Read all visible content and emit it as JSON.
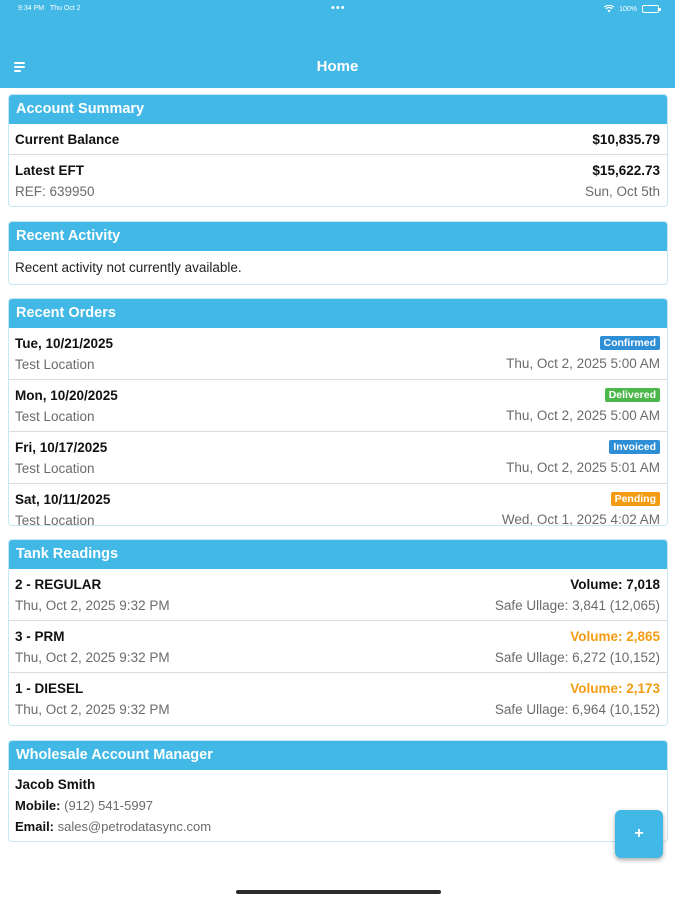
{
  "status_bar": {
    "time": "9:34 PM",
    "date": "Thu Oct 2",
    "dots": "•••",
    "battery": "100%"
  },
  "header": {
    "title": "Home",
    "menu_icon": "hamburger-menu-icon"
  },
  "colors": {
    "accent": "#42b8e6",
    "confirmed": "#2e8fd6",
    "delivered": "#4cb84c",
    "invoiced": "#2e8fd6",
    "pending": "#f39c12",
    "warning_text": "#f39c12"
  },
  "account_summary": {
    "title": "Account Summary",
    "current_balance_label": "Current Balance",
    "current_balance_value": "$10,835.79",
    "latest_eft_label": "Latest EFT",
    "latest_eft_value": "$15,622.73",
    "latest_eft_ref": "REF: 639950",
    "latest_eft_date": "Sun, Oct 5th"
  },
  "recent_activity": {
    "title": "Recent Activity",
    "message": "Recent activity not currently available."
  },
  "recent_orders": {
    "title": "Recent Orders",
    "orders": [
      {
        "date": "Tue, 10/21/2025",
        "location": "Test Location",
        "status": "Confirmed",
        "timestamp": "Thu, Oct 2, 2025 5:00 AM"
      },
      {
        "date": "Mon, 10/20/2025",
        "location": "Test Location",
        "status": "Delivered",
        "timestamp": "Thu, Oct 2, 2025 5:00 AM"
      },
      {
        "date": "Fri, 10/17/2025",
        "location": "Test Location",
        "status": "Invoiced",
        "timestamp": "Thu, Oct 2, 2025 5:01 AM"
      },
      {
        "date": "Sat, 10/11/2025",
        "location": "Test Location",
        "status": "Pending",
        "timestamp": "Wed, Oct 1, 2025 4:02 AM"
      }
    ]
  },
  "tank_readings": {
    "title": "Tank Readings",
    "tanks": [
      {
        "name": "2 - REGULAR",
        "timestamp": "Thu, Oct 2, 2025 9:32 PM",
        "volume": "Volume: 7,018",
        "ullage": "Safe Ullage: 3,841 (12,065)"
      },
      {
        "name": "3 - PRM",
        "timestamp": "Thu, Oct 2, 2025 9:32 PM",
        "volume": "Volume: 2,865",
        "ullage": "Safe Ullage: 6,272 (10,152)"
      },
      {
        "name": "1 - DIESEL",
        "timestamp": "Thu, Oct 2, 2025 9:32 PM",
        "volume": "Volume: 2,173",
        "ullage": "Safe Ullage: 6,964 (10,152)"
      }
    ]
  },
  "account_manager": {
    "title": "Wholesale Account Manager",
    "name": "Jacob Smith",
    "mobile_label": "Mobile:",
    "mobile_value": "(912) 541-5997",
    "email_label": "Email:",
    "email_value": "sales@petrodatasync.com"
  },
  "fab": {
    "label": "+"
  }
}
